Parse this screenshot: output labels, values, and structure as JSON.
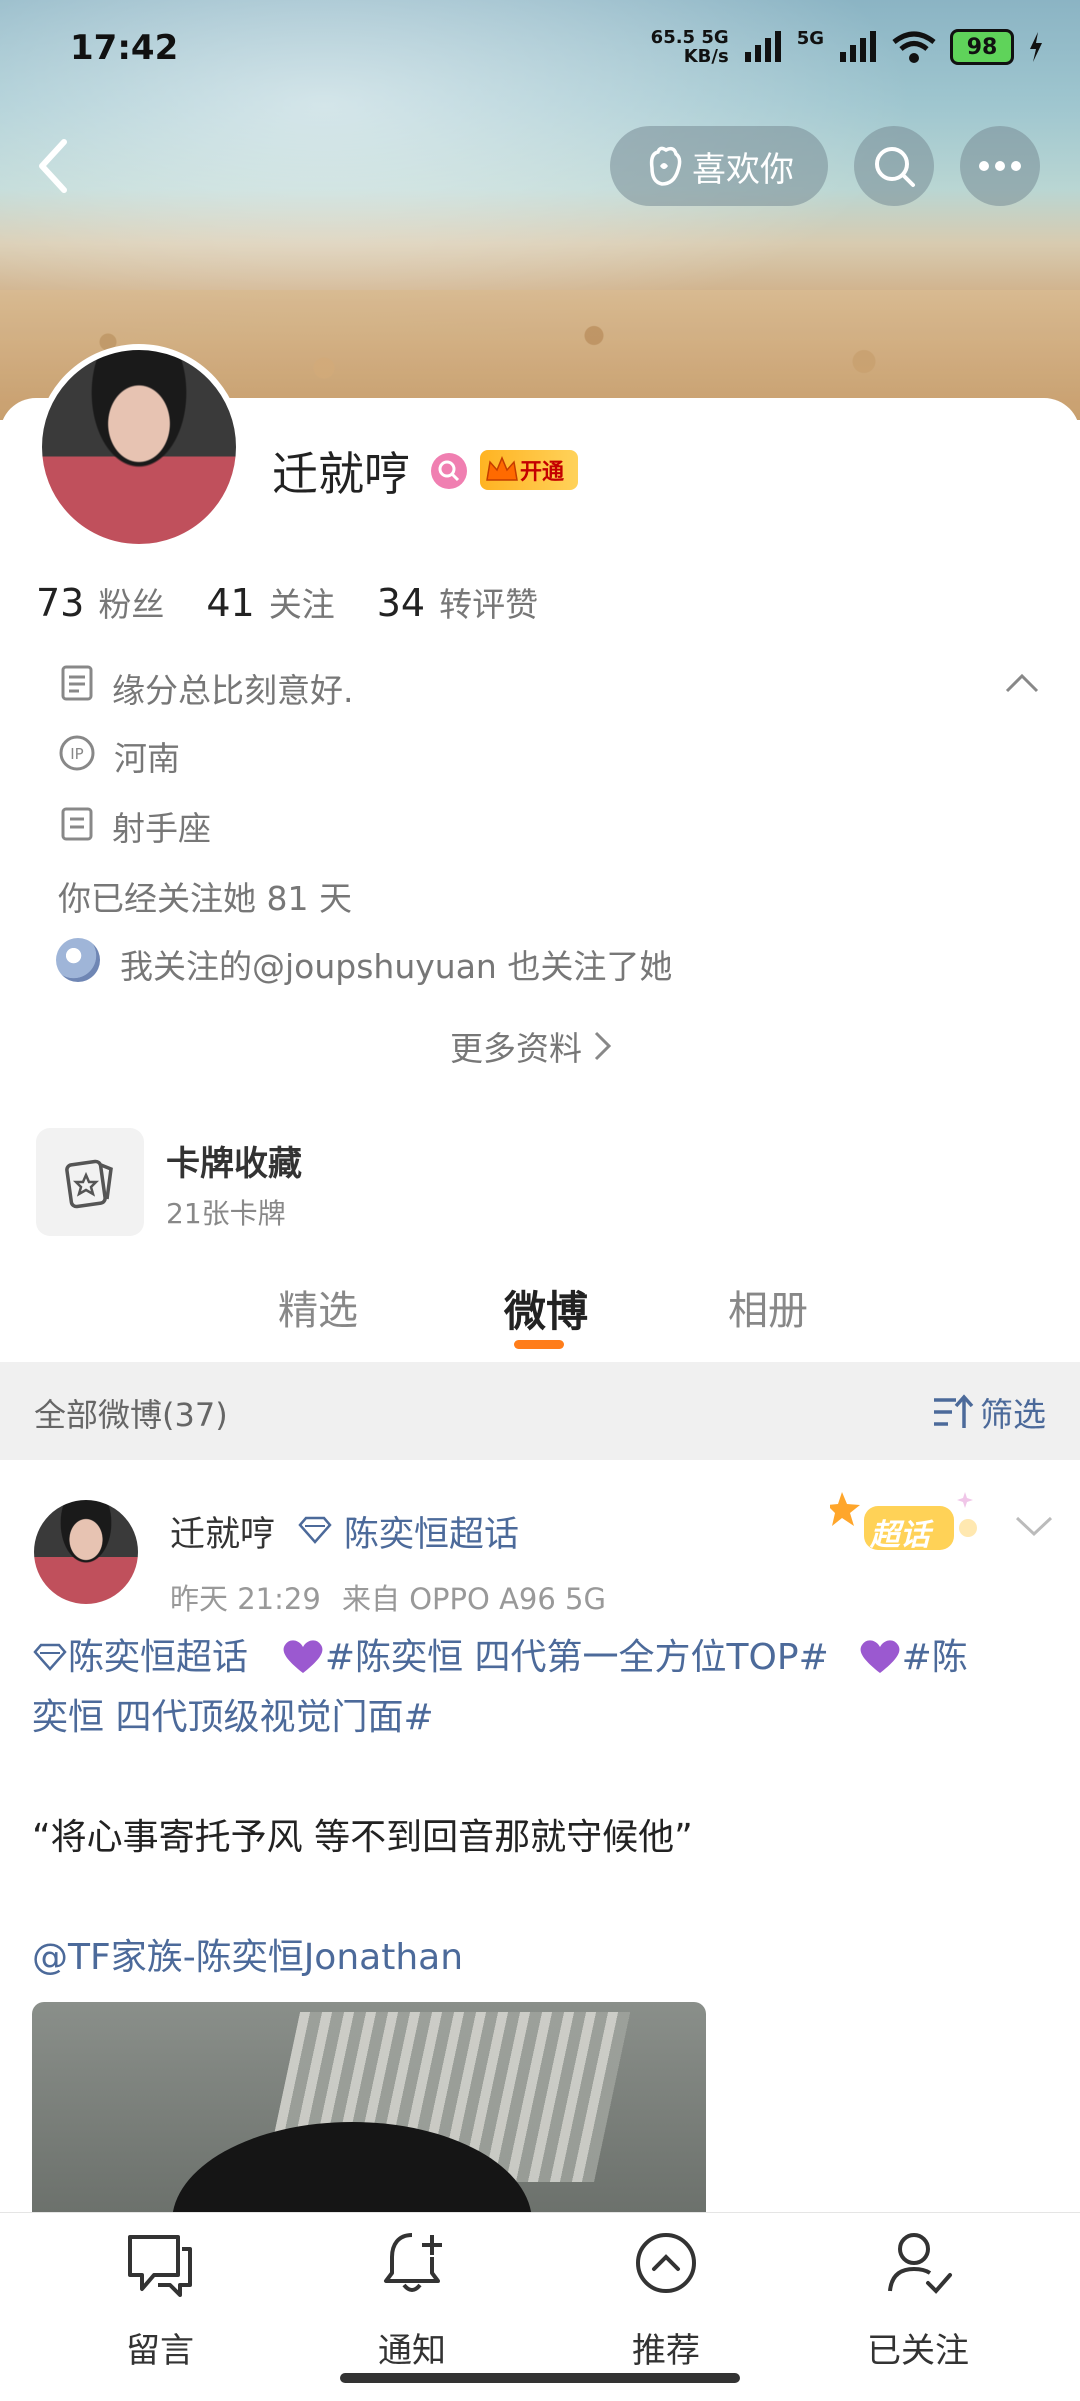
{
  "status_bar": {
    "time": "17:42",
    "net_speed": "65.5",
    "net_unit": "KB/s",
    "net_tag1": "5G",
    "net_tag2": "5G",
    "battery": "98"
  },
  "header": {
    "like_button": "喜欢你"
  },
  "profile": {
    "name": "迁就哼",
    "vip_badge": "开通",
    "stats": [
      {
        "value": "73",
        "label": "粉丝"
      },
      {
        "value": "41",
        "label": "关注"
      },
      {
        "value": "34",
        "label": "转评赞"
      }
    ],
    "bio": "缘分总比刻意好.",
    "location": "河南",
    "zodiac": "射手座",
    "follow_duration": "你已经关注她 81 天",
    "mutual_follow": "我关注的@joupshuyuan 也关注了她",
    "more_info": "更多资料"
  },
  "card_collection": {
    "title": "卡牌收藏",
    "count": "21张卡牌"
  },
  "tabs": [
    "精选",
    "微博",
    "相册"
  ],
  "active_tab": "微博",
  "filter_bar": {
    "label": "全部微博(37)",
    "filter": "筛选"
  },
  "post": {
    "author": "迁就哼",
    "topic": "陈奕恒超话",
    "super_badge": "超话",
    "time": "昨天 21:29",
    "source": "来自 OPPO A96 5G",
    "line1_topic": "陈奕恒超话",
    "line1_tag1": "#陈奕恒 四代第一全方位TOP#",
    "line1_tag2_start": "#陈",
    "line2_tag2_end": "奕恒 四代顶级视觉门面#",
    "quote": "“将心事寄托予风  等不到回音那就守候他”",
    "mention": "@TF家族-陈奕恒Jonathan"
  },
  "bottom_nav": [
    {
      "label": "留言",
      "icon": "message-icon"
    },
    {
      "label": "通知",
      "icon": "bell-add-icon"
    },
    {
      "label": "推荐",
      "icon": "up-circle-icon"
    },
    {
      "label": "已关注",
      "icon": "user-check-icon"
    }
  ],
  "colors": {
    "accent_orange": "#ff7d1a",
    "link_blue": "#4c6a9a",
    "purple_heart": "#9b59d0"
  }
}
